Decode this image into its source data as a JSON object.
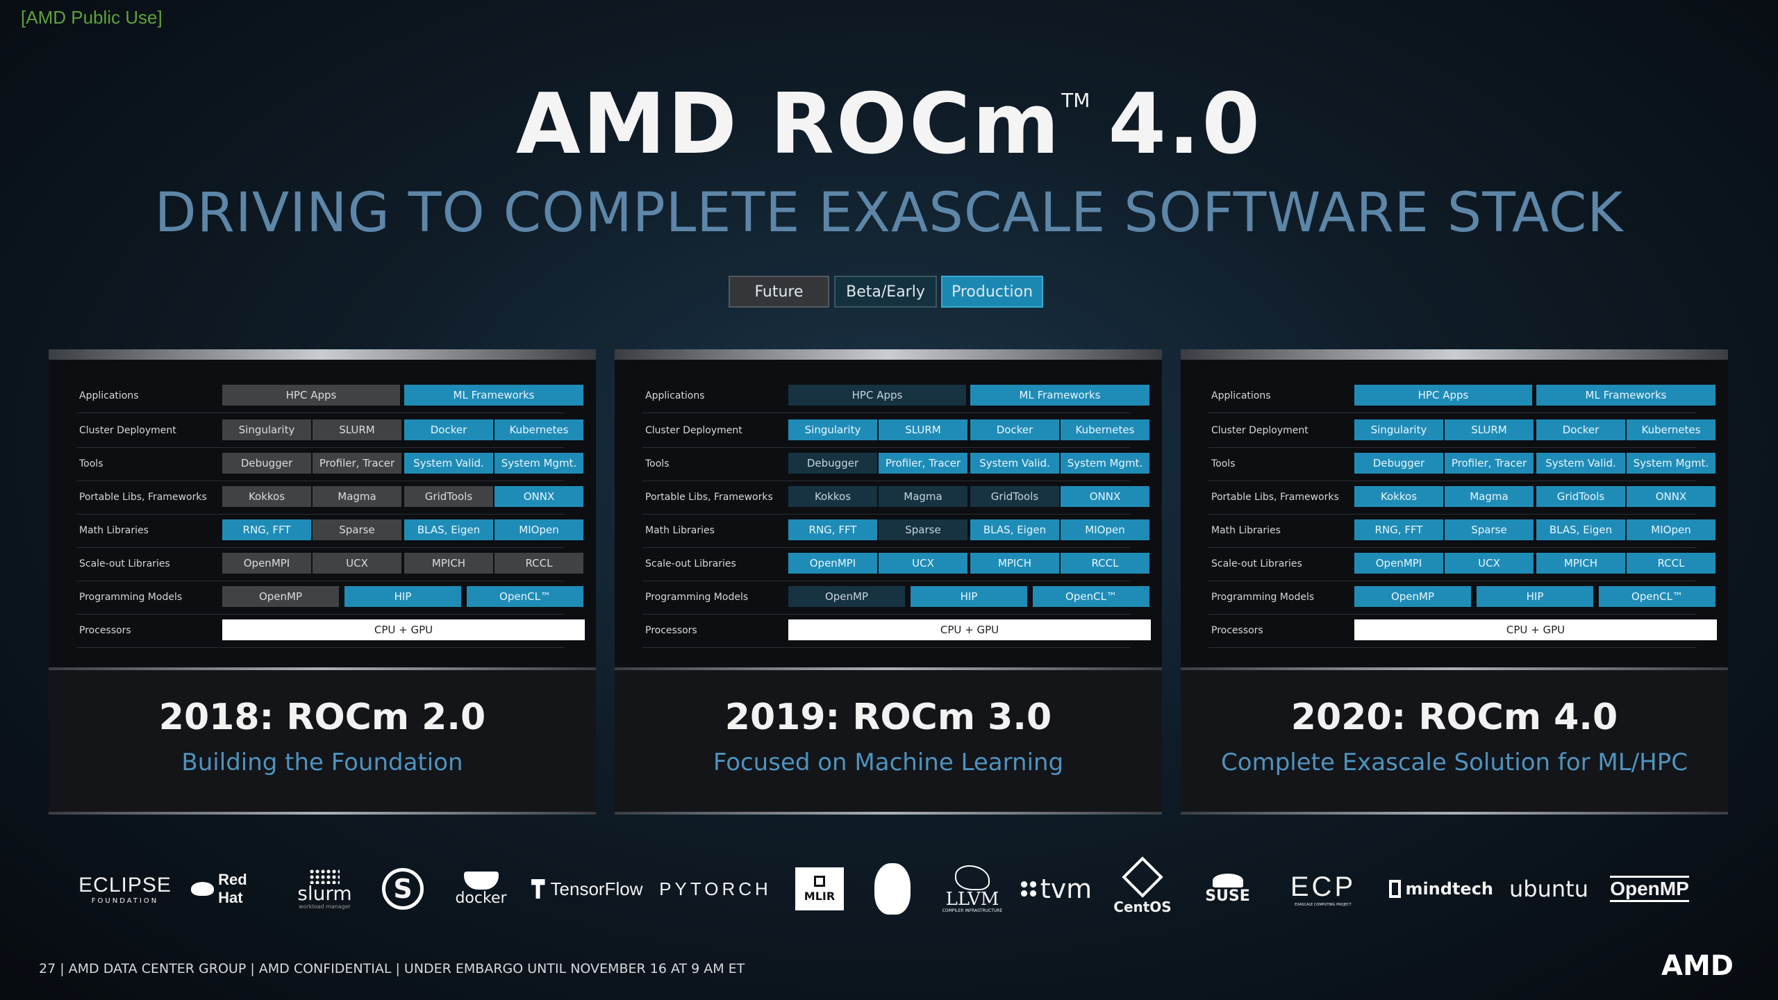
{
  "public_tag": "[AMD Public Use]",
  "title": {
    "text": "AMD ROCm",
    "tm": "TM",
    "version": "4.0"
  },
  "subtitle": "DRIVING TO COMPLETE EXASCALE SOFTWARE STACK",
  "legend": {
    "future": "Future",
    "beta": "Beta/Early",
    "production": "Production"
  },
  "colors": {
    "future": "#404246",
    "beta": "#173342",
    "production": "#1f8cb7",
    "accent_blue": "#4f93bf"
  },
  "row_labels": [
    "Applications",
    "Cluster Deployment",
    "Tools",
    "Portable Libs, Frameworks",
    "Math Libraries",
    "Scale-out Libraries",
    "Programming Models",
    "Processors"
  ],
  "panels": [
    {
      "year_title": "2018: ROCm 2.0",
      "description": "Building the Foundation",
      "rows": [
        [
          {
            "t": "HPC Apps",
            "s": "future"
          },
          {
            "t": "ML Frameworks",
            "s": "prod"
          }
        ],
        [
          {
            "t": "Singularity",
            "s": "future"
          },
          {
            "t": "SLURM",
            "s": "future"
          },
          {
            "t": "Docker",
            "s": "prod"
          },
          {
            "t": "Kubernetes",
            "s": "prod"
          }
        ],
        [
          {
            "t": "Debugger",
            "s": "future"
          },
          {
            "t": "Profiler, Tracer",
            "s": "future"
          },
          {
            "t": "System Valid.",
            "s": "prod"
          },
          {
            "t": "System Mgmt.",
            "s": "prod"
          }
        ],
        [
          {
            "t": "Kokkos",
            "s": "future"
          },
          {
            "t": "Magma",
            "s": "future"
          },
          {
            "t": "GridTools",
            "s": "future"
          },
          {
            "t": "ONNX",
            "s": "prod"
          }
        ],
        [
          {
            "t": "RNG, FFT",
            "s": "prod"
          },
          {
            "t": "Sparse",
            "s": "future"
          },
          {
            "t": "BLAS, Eigen",
            "s": "prod"
          },
          {
            "t": "MIOpen",
            "s": "prod"
          }
        ],
        [
          {
            "t": "OpenMPI",
            "s": "future"
          },
          {
            "t": "UCX",
            "s": "future"
          },
          {
            "t": "MPICH",
            "s": "future"
          },
          {
            "t": "RCCL",
            "s": "future"
          }
        ],
        [
          {
            "t": "OpenMP",
            "s": "future"
          },
          {
            "t": "HIP",
            "s": "prod"
          },
          {
            "t": "OpenCL™",
            "s": "prod"
          }
        ],
        [
          {
            "t": "CPU + GPU",
            "s": "white"
          }
        ]
      ]
    },
    {
      "year_title": "2019: ROCm 3.0",
      "description": "Focused on Machine Learning",
      "rows": [
        [
          {
            "t": "HPC Apps",
            "s": "beta"
          },
          {
            "t": "ML Frameworks",
            "s": "prod"
          }
        ],
        [
          {
            "t": "Singularity",
            "s": "prod"
          },
          {
            "t": "SLURM",
            "s": "prod"
          },
          {
            "t": "Docker",
            "s": "prod"
          },
          {
            "t": "Kubernetes",
            "s": "prod"
          }
        ],
        [
          {
            "t": "Debugger",
            "s": "beta"
          },
          {
            "t": "Profiler, Tracer",
            "s": "prod"
          },
          {
            "t": "System Valid.",
            "s": "prod"
          },
          {
            "t": "System Mgmt.",
            "s": "prod"
          }
        ],
        [
          {
            "t": "Kokkos",
            "s": "beta"
          },
          {
            "t": "Magma",
            "s": "beta"
          },
          {
            "t": "GridTools",
            "s": "beta"
          },
          {
            "t": "ONNX",
            "s": "prod"
          }
        ],
        [
          {
            "t": "RNG, FFT",
            "s": "prod"
          },
          {
            "t": "Sparse",
            "s": "beta"
          },
          {
            "t": "BLAS, Eigen",
            "s": "prod"
          },
          {
            "t": "MIOpen",
            "s": "prod"
          }
        ],
        [
          {
            "t": "OpenMPI",
            "s": "prod"
          },
          {
            "t": "UCX",
            "s": "prod"
          },
          {
            "t": "MPICH",
            "s": "prod"
          },
          {
            "t": "RCCL",
            "s": "prod"
          }
        ],
        [
          {
            "t": "OpenMP",
            "s": "beta"
          },
          {
            "t": "HIP",
            "s": "prod"
          },
          {
            "t": "OpenCL™",
            "s": "prod"
          }
        ],
        [
          {
            "t": "CPU + GPU",
            "s": "white"
          }
        ]
      ]
    },
    {
      "year_title": "2020: ROCm 4.0",
      "description": "Complete Exascale Solution for ML/HPC",
      "rows": [
        [
          {
            "t": "HPC Apps",
            "s": "prod"
          },
          {
            "t": "ML Frameworks",
            "s": "prod"
          }
        ],
        [
          {
            "t": "Singularity",
            "s": "prod"
          },
          {
            "t": "SLURM",
            "s": "prod"
          },
          {
            "t": "Docker",
            "s": "prod"
          },
          {
            "t": "Kubernetes",
            "s": "prod"
          }
        ],
        [
          {
            "t": "Debugger",
            "s": "prod"
          },
          {
            "t": "Profiler, Tracer",
            "s": "prod"
          },
          {
            "t": "System Valid.",
            "s": "prod"
          },
          {
            "t": "System Mgmt.",
            "s": "prod"
          }
        ],
        [
          {
            "t": "Kokkos",
            "s": "prod"
          },
          {
            "t": "Magma",
            "s": "prod"
          },
          {
            "t": "GridTools",
            "s": "prod"
          },
          {
            "t": "ONNX",
            "s": "prod"
          }
        ],
        [
          {
            "t": "RNG, FFT",
            "s": "prod"
          },
          {
            "t": "Sparse",
            "s": "prod"
          },
          {
            "t": "BLAS, Eigen",
            "s": "prod"
          },
          {
            "t": "MIOpen",
            "s": "prod"
          }
        ],
        [
          {
            "t": "OpenMPI",
            "s": "prod"
          },
          {
            "t": "UCX",
            "s": "prod"
          },
          {
            "t": "MPICH",
            "s": "prod"
          },
          {
            "t": "RCCL",
            "s": "prod"
          }
        ],
        [
          {
            "t": "OpenMP",
            "s": "prod"
          },
          {
            "t": "HIP",
            "s": "prod"
          },
          {
            "t": "OpenCL™",
            "s": "prod"
          }
        ],
        [
          {
            "t": "CPU + GPU",
            "s": "white"
          }
        ]
      ]
    }
  ],
  "logos": [
    {
      "icon": "eclipse-logo-icon",
      "text": "ECLIPSE",
      "sub": "FOUNDATION"
    },
    {
      "icon": "redhat-logo-icon",
      "text": "Red Hat",
      "sub": ""
    },
    {
      "icon": "slurm-logo-icon",
      "text": "slurm",
      "sub": "workload manager"
    },
    {
      "icon": "singularity-logo-icon",
      "text": "S",
      "sub": ""
    },
    {
      "icon": "docker-logo-icon",
      "text": "docker",
      "sub": ""
    },
    {
      "icon": "tensorflow-logo-icon",
      "text": "TensorFlow",
      "sub": ""
    },
    {
      "icon": "pytorch-logo-icon",
      "text": "PYTORCH",
      "sub": ""
    },
    {
      "icon": "mlir-logo-icon",
      "text": "MLIR",
      "sub": ""
    },
    {
      "icon": "linux-tux-icon",
      "text": "",
      "sub": ""
    },
    {
      "icon": "llvm-logo-icon",
      "text": "LLVM",
      "sub": "COMPILER INFRASTRUCTURE"
    },
    {
      "icon": "tvm-logo-icon",
      "text": "tvm",
      "sub": ""
    },
    {
      "icon": "centos-logo-icon",
      "text": "CentOS",
      "sub": ""
    },
    {
      "icon": "suse-logo-icon",
      "text": "SUSE",
      "sub": ""
    },
    {
      "icon": "ecp-logo-icon",
      "text": "ECP",
      "sub": "EXASCALE COMPUTING PROJECT"
    },
    {
      "icon": "mindtech-logo-icon",
      "text": "mindtech",
      "sub": ""
    },
    {
      "icon": "ubuntu-logo-icon",
      "text": "ubuntu",
      "sub": ""
    },
    {
      "icon": "openmp-logo-icon",
      "text": "OpenMP",
      "sub": ""
    }
  ],
  "footer": "27    |  AMD DATA CENTER GROUP  |  AMD CONFIDENTIAL  |  UNDER EMBARGO UNTIL NOVEMBER 16 AT 9 AM ET",
  "brand_logo": "AMD"
}
